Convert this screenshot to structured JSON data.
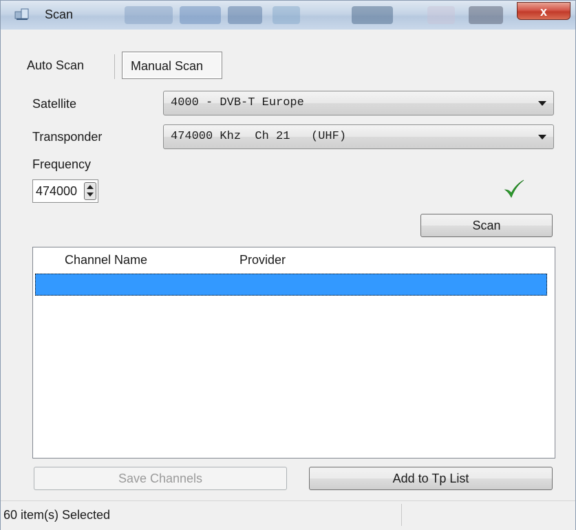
{
  "window": {
    "title": "Scan",
    "close_label": "x"
  },
  "tabs": [
    {
      "label": "Auto Scan",
      "selected": false
    },
    {
      "label": "Manual Scan",
      "selected": true
    }
  ],
  "form": {
    "satellite_label": "Satellite",
    "satellite_value": "4000 - DVB-T Europe",
    "transponder_label": "Transponder",
    "transponder_value": "474000 Khz  Ch 21   (UHF)",
    "frequency_label": "Frequency",
    "frequency_value": "474000"
  },
  "status_indicator": {
    "icon": "checkmark-icon",
    "color": "#2e9e2e"
  },
  "buttons": {
    "scan": "Scan",
    "save_channels": "Save Channels",
    "add_to_tp_list": "Add to Tp List"
  },
  "channel_list": {
    "columns": [
      "Channel Name",
      "Provider"
    ],
    "selection_color": "#3399ff"
  },
  "statusbar": {
    "text": "60 item(s) Selected"
  }
}
